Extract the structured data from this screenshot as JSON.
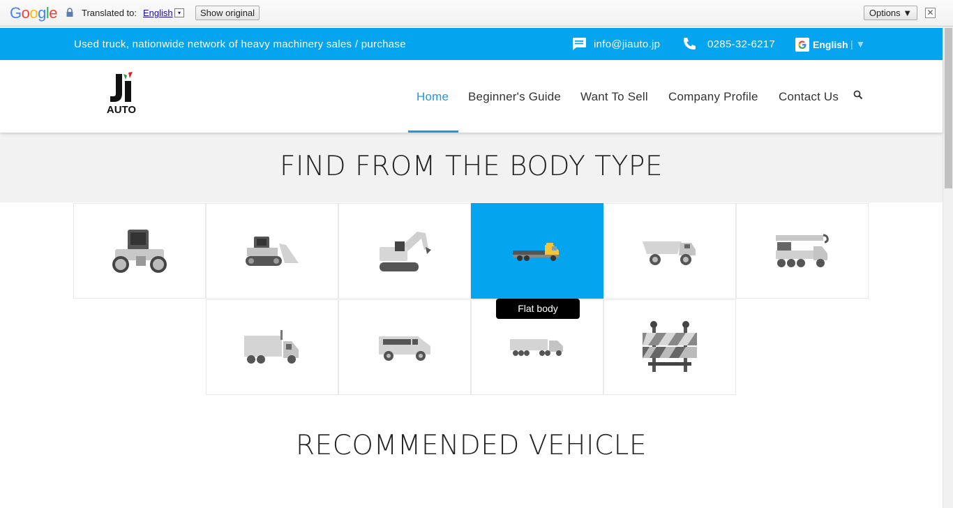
{
  "translate_bar": {
    "logo_letters": [
      "G",
      "o",
      "o",
      "g",
      "l",
      "e"
    ],
    "translated_to_label": "Translated to:",
    "language": "English",
    "language_arrow": "▾",
    "show_original": "Show original",
    "options": "Options ▼",
    "close": "✕"
  },
  "topbar": {
    "tagline": "Used truck, nationwide network of heavy machinery sales / purchase",
    "email": "info@jiauto.jp",
    "phone": "0285-32-6217",
    "language": "English",
    "language_sep": "| ▼"
  },
  "logo": {
    "line1": "JI",
    "line2": "AUTO"
  },
  "nav": {
    "items": [
      "Home",
      "Beginner's Guide",
      "Want To Sell",
      "Company Profile",
      "Contact Us"
    ],
    "active": "Home"
  },
  "find": {
    "title": "FIND FROM THE BODY TYPE",
    "tooltip": "Flat body"
  },
  "recommended": {
    "title": "RECOMMENDED VEHICLE"
  },
  "colors": {
    "accent": "#04a4ef",
    "nav_active": "#1c9ae0"
  }
}
